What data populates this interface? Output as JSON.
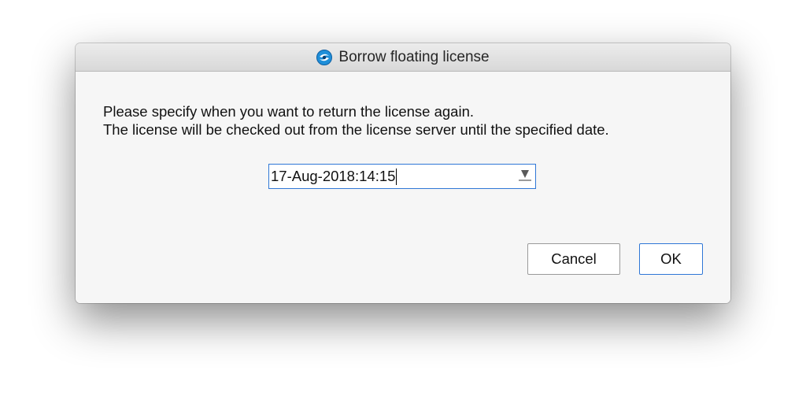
{
  "window": {
    "title": "Borrow floating license",
    "icon": "app-logo-icon"
  },
  "message": {
    "line1": "Please specify when you want to return the license again.",
    "line2": "The license will be checked out from the license server until the specified date."
  },
  "return_date": {
    "value": "17-Aug-2018:14:15",
    "dropdown_icon": "triangle-down-icon"
  },
  "buttons": {
    "cancel_label": "Cancel",
    "ok_label": "OK"
  },
  "colors": {
    "focus_accent": "#2f77d6",
    "icon_blue": "#1f8fd9"
  }
}
